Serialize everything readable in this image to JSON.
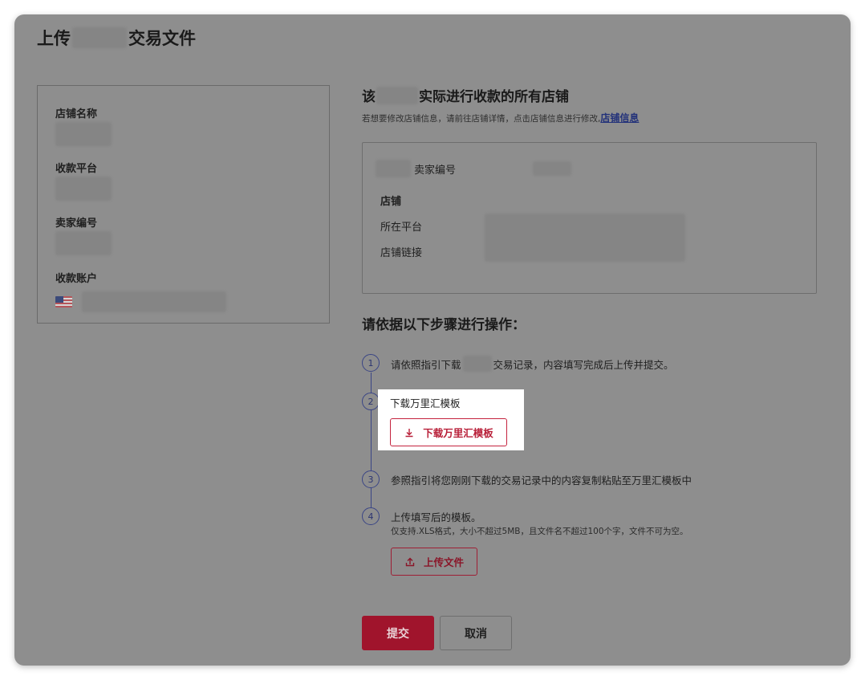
{
  "header": {
    "title_prefix": "上传",
    "title_suffix": "交易文件"
  },
  "left_panel": {
    "store_name_label": "店铺名称",
    "platform_label": "收款平台",
    "seller_id_label": "卖家编号",
    "account_label": "收款账户",
    "account_flag": "us-flag-icon"
  },
  "right_panel": {
    "title_prefix": "该",
    "title_suffix": "实际进行收款的所有店铺",
    "hint": "若想要修改店铺信息，请前往店铺详情，点击店铺信息进行修改,",
    "hint_link": "店铺信息",
    "store_card": {
      "seller_label": "卖家编号",
      "store_label": "店铺",
      "platform_label": "所在平台",
      "link_label": "店铺链接"
    }
  },
  "steps": {
    "title": "请依据以下步骤进行操作：",
    "items": [
      {
        "num": "1",
        "text_prefix": "请依照指引下载",
        "text_suffix": "交易记录，内容填写完成后上传并提交。"
      },
      {
        "num": "2",
        "text": "下载万里汇模板",
        "button": "下载万里汇模板"
      },
      {
        "num": "3",
        "text": "参照指引将您刚刚下载的交易记录中的内容复制粘贴至万里汇模板中"
      },
      {
        "num": "4",
        "text": "上传填写后的模板。",
        "sub": "仅支持.XLS格式，大小不超过5MB，且文件名不超过100个字，文件不可为空。",
        "button": "上传文件"
      }
    ]
  },
  "actions": {
    "submit": "提交",
    "cancel": "取消"
  },
  "colors": {
    "accent": "#b81f38",
    "primary_button": "#a0142c",
    "step_line": "#3a4585",
    "link": "#23327a"
  }
}
